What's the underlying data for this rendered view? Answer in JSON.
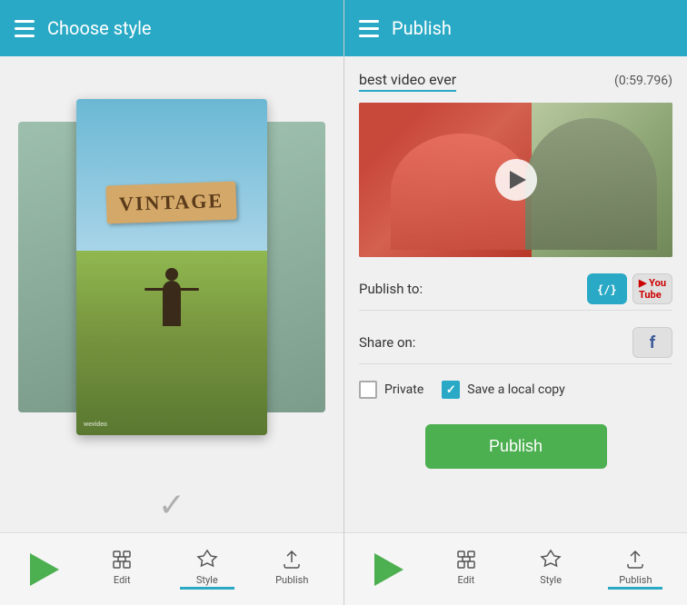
{
  "left": {
    "header": {
      "title": "Choose style",
      "menu_icon": "hamburger-icon"
    },
    "vintage_card": {
      "label": "VINTAGE"
    },
    "toolbar": {
      "play_label": "play",
      "edit_label": "Edit",
      "style_label": "Style",
      "publish_label": "Publish"
    }
  },
  "right": {
    "header": {
      "title": "Publish",
      "menu_icon": "hamburger-icon"
    },
    "video": {
      "title": "best video ever",
      "duration": "(0:59.796)"
    },
    "publish_to": {
      "label": "Publish to:",
      "buttons": [
        "WeVideo",
        "YouTube"
      ]
    },
    "share_on": {
      "label": "Share on:",
      "buttons": [
        "Facebook"
      ]
    },
    "options": {
      "private_label": "Private",
      "private_checked": false,
      "local_copy_label": "Save a local copy",
      "local_copy_checked": true
    },
    "publish_button_label": "Publish",
    "toolbar": {
      "play_label": "play",
      "edit_label": "Edit",
      "style_label": "Style",
      "publish_label": "Publish"
    }
  }
}
